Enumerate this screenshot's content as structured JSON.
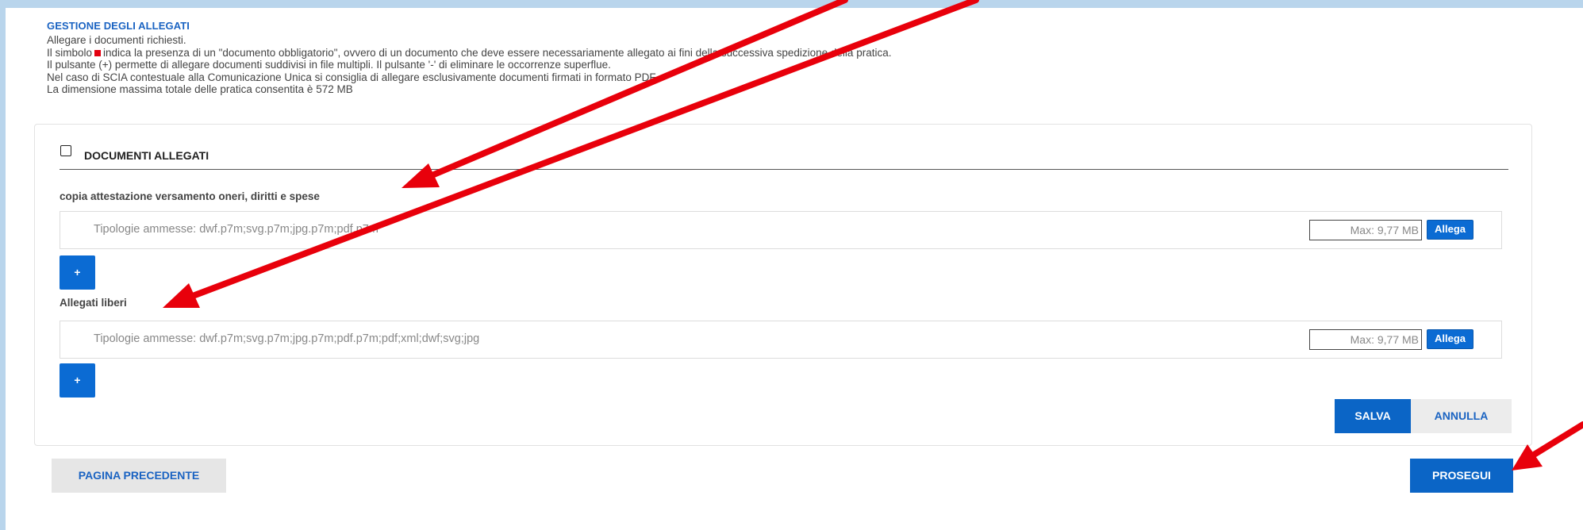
{
  "section": {
    "title": "GESTIONE DEGLI ALLEGATI",
    "intro": {
      "line1": "Allegare i documenti richiesti.",
      "line2_before": "Il simbolo",
      "line2_after": "indica la presenza di un \"documento obbligatorio\", ovvero di un documento che deve essere necessariamente allegato ai fini della successiva spedizione della pratica.",
      "line3": "Il pulsante (+) permette di allegare documenti suddivisi in file multipli. Il pulsante '-' di eliminare le occorrenze superflue.",
      "line4": "Nel caso di SCIA contestuale alla Comunicazione Unica si consiglia di allegare esclusivamente documenti firmati in formato PDF.",
      "line5": "La dimensione massima totale delle pratica consentita è 572 MB"
    }
  },
  "card": {
    "title": "DOCUMENTI ALLEGATI",
    "checkbox_checked": false,
    "groups": [
      {
        "label": "copia attestazione versamento oneri, diritti e spese",
        "hint": "Tipologie ammesse: dwf.p7m;svg.p7m;jpg.p7m;pdf.p7m",
        "max": "Max: 9,77 MB",
        "attach_label": "Allega",
        "add_label": "+"
      },
      {
        "label": "Allegati liberi",
        "hint": "Tipologie ammesse: dwf.p7m;svg.p7m;jpg.p7m;pdf.p7m;pdf;xml;dwf;svg;jpg",
        "max": "Max: 9,77 MB",
        "attach_label": "Allega",
        "add_label": "+"
      }
    ],
    "save_label": "SALVA",
    "cancel_label": "ANNULLA"
  },
  "footer": {
    "prev_label": "PAGINA PRECEDENTE",
    "next_label": "PROSEGUI"
  },
  "colors": {
    "accent": "#0b65c6",
    "required_mark": "#e3000f",
    "annotation_arrow": "#e8000b",
    "background": "#b9d5ec"
  }
}
